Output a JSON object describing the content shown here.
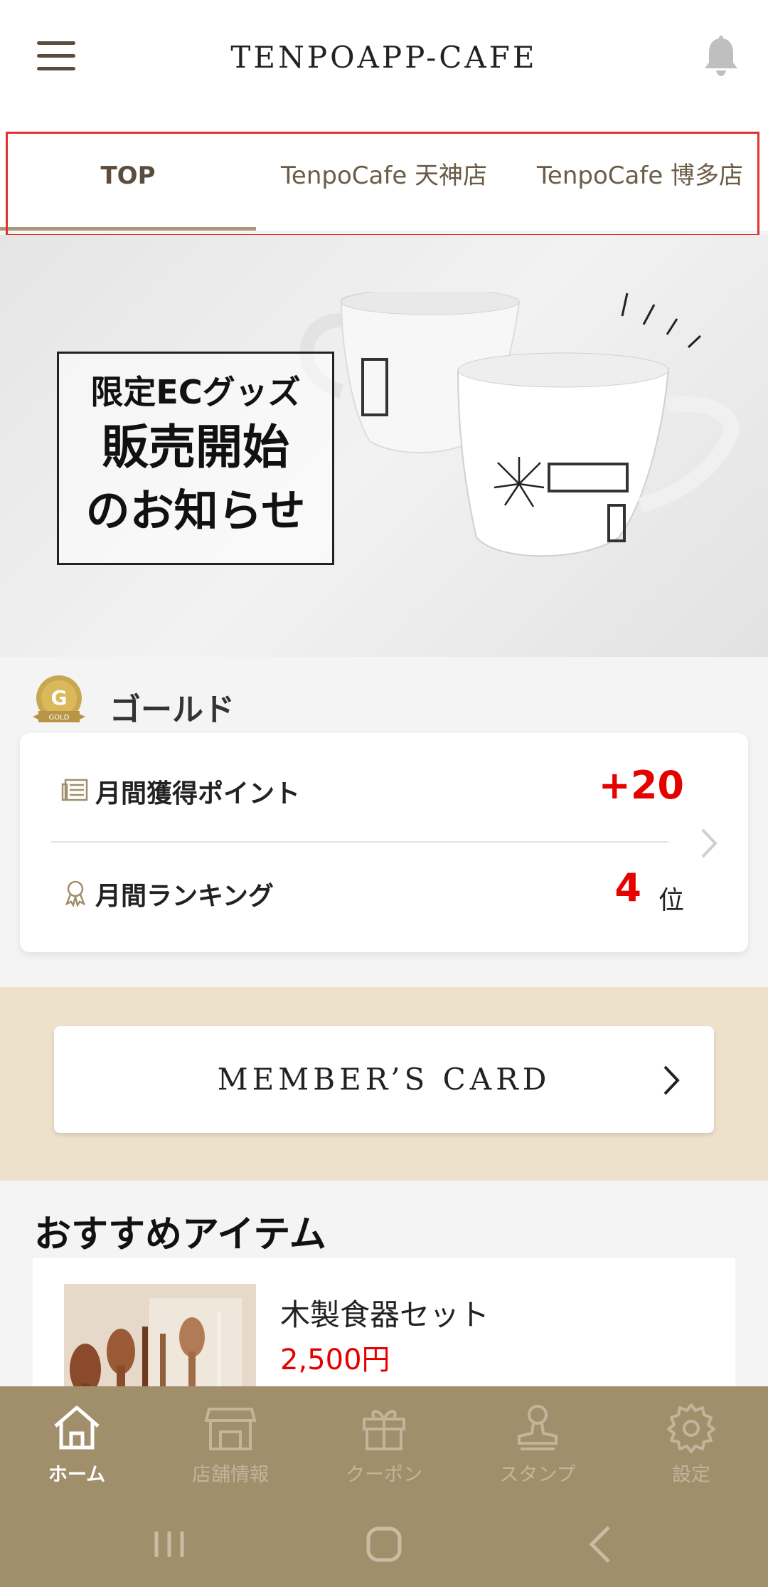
{
  "header": {
    "title": "TENPOAPP-CAFE",
    "menu_icon": "hamburger-menu-icon",
    "bell_icon": "bell-icon"
  },
  "tabs": [
    {
      "label": "TOP",
      "active": true
    },
    {
      "label": "TenpoCafe 天神店",
      "active": false
    },
    {
      "label": "TenpoCafe 博多店",
      "active": false
    }
  ],
  "banner": {
    "line1": "限定ECグッズ",
    "line2": "販売開始",
    "line3": "のお知らせ"
  },
  "rank": {
    "badge_letter": "G",
    "badge_text": "GOLD",
    "name": "ゴールド"
  },
  "points": {
    "monthly_points_label": "月間獲得ポイント",
    "monthly_points_value": "+20",
    "monthly_ranking_label": "月間ランキング",
    "monthly_ranking_value": "4",
    "monthly_ranking_unit": "位"
  },
  "member_card": {
    "label": "MEMBER’S CARD"
  },
  "recommended": {
    "title": "おすすめアイテム",
    "items": [
      {
        "name": "木製食器セット",
        "price": "2,500円"
      }
    ]
  },
  "bottom_nav": [
    {
      "label": "ホーム",
      "icon": "home-icon",
      "active": true
    },
    {
      "label": "店舗情報",
      "icon": "store-icon",
      "active": false
    },
    {
      "label": "クーポン",
      "icon": "gift-icon",
      "active": false
    },
    {
      "label": "スタンプ",
      "icon": "stamp-icon",
      "active": false
    },
    {
      "label": "設定",
      "icon": "gear-icon",
      "active": false
    }
  ],
  "colors": {
    "accent": "#a18f6c",
    "price_red": "#e60000",
    "highlight_red": "#e53030",
    "member_bg": "#ede1cb"
  }
}
